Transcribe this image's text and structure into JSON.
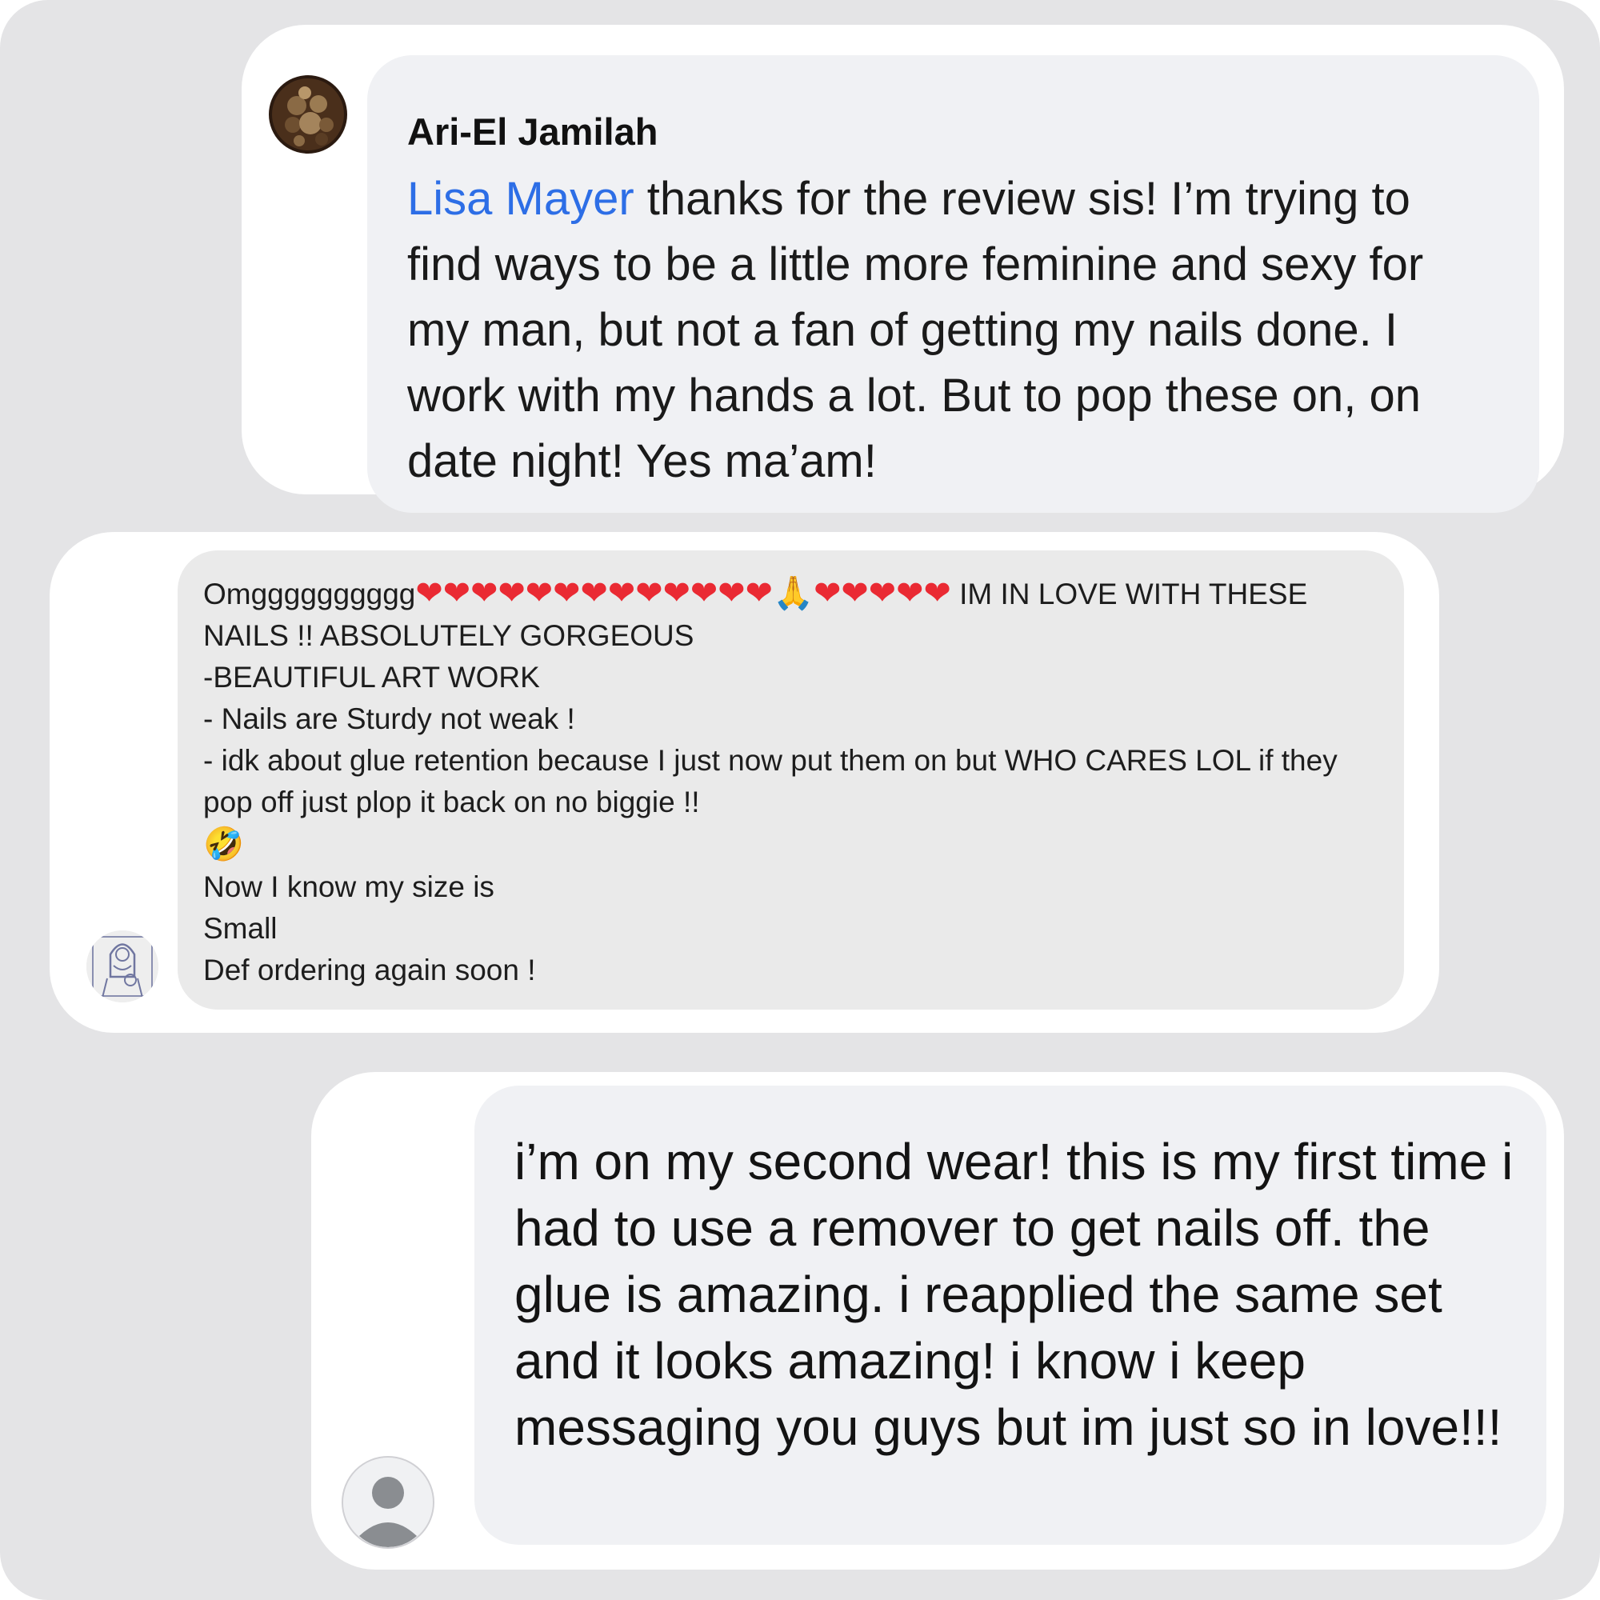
{
  "comments": [
    {
      "author": "Ari-El Jamilah",
      "mention": "Lisa Mayer",
      "text": " thanks for the review sis! I’m trying to find ways to be a little more feminine and sexy for my man, but not a fan of getting my nails done. I work with my hands a lot. But to pop these on, on date night! Yes ma’am!"
    },
    {
      "prefix": "Omgggggggggg",
      "hearts_before_pray": "❤❤❤❤❤❤❤❤❤❤❤❤❤",
      "pray_emoji": "🙏",
      "hearts_after_pray": "❤❤❤❤❤",
      "text": " IM IN LOVE WITH THESE NAILS !! ABSOLUTELY GORGEOUS\n-BEAUTIFUL ART WORK\n- Nails are Sturdy not weak !\n- idk about glue retention because I just now put them on but WHO CARES LOL if they pop off just plop it back on no biggie !!",
      "laugh_emoji": "🤣",
      "text_after": "Now I know my size is\nSmall\nDef ordering again soon !"
    },
    {
      "text": "i’m on my second wear! this is my first time i had to use a remover to get nails off. the glue is amazing. i reapplied the same set and it looks amazing! i know i keep messaging you guys but im just so in love!!!"
    }
  ],
  "colors": {
    "mention": "#2d6ee6",
    "heart": "#ea2a33"
  }
}
